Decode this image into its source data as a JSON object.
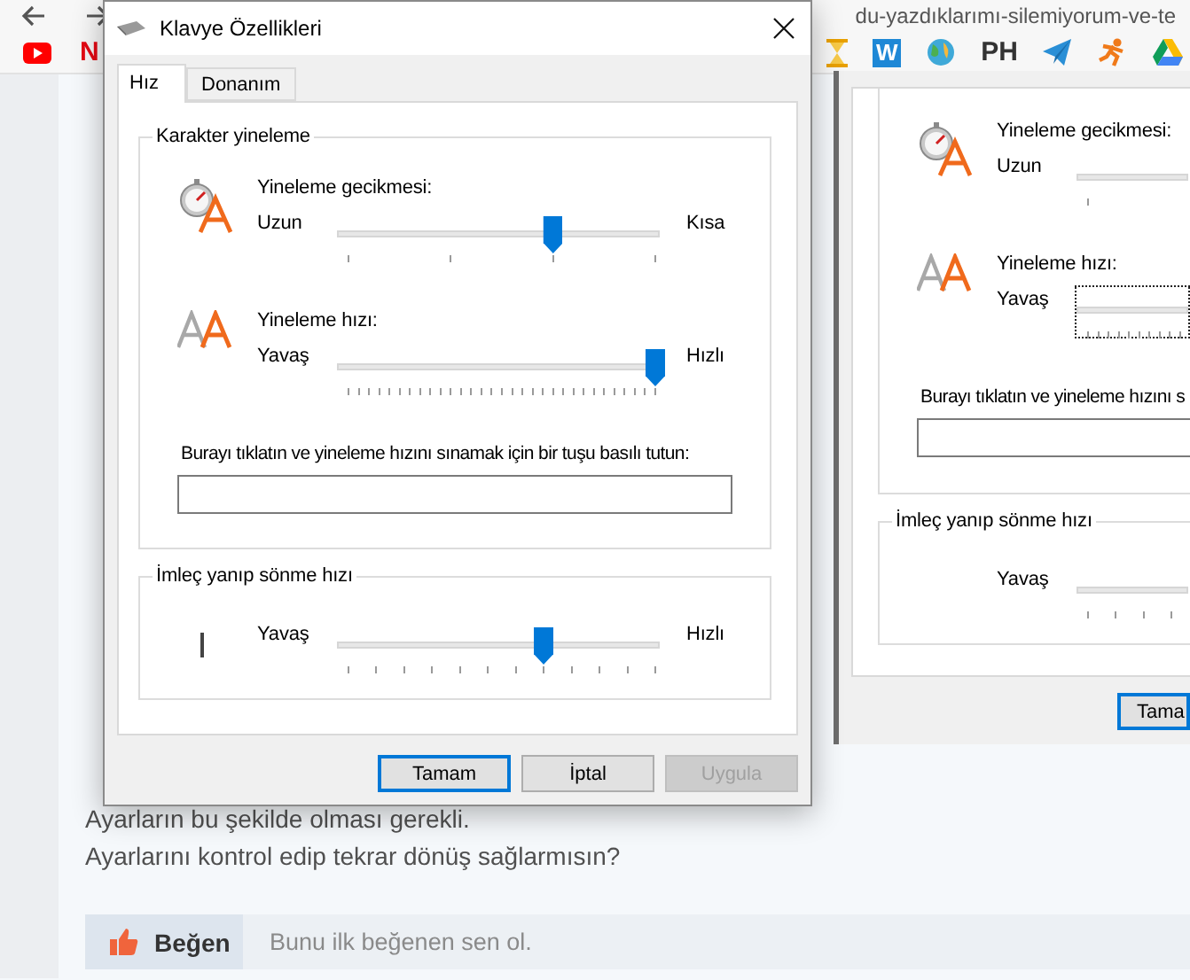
{
  "browser": {
    "address": "du-yazdıklarımı-silemiyorum-ve-te",
    "bookmarks_left": [
      {
        "kind": "play"
      },
      {
        "kind": "letter",
        "label": "N",
        "color": "#e50914"
      }
    ],
    "bookmarks_right": [
      {
        "kind": "hourglass"
      },
      {
        "kind": "tile",
        "label": "W"
      },
      {
        "kind": "globe"
      },
      {
        "kind": "letter",
        "label": "PH",
        "color": "#333333"
      },
      {
        "kind": "plane"
      },
      {
        "kind": "runner"
      },
      {
        "kind": "drive"
      }
    ]
  },
  "post": {
    "lines": [
      "Ayarların bu şekilde olması gerekli.",
      "Ayarlarını kontrol edip tekrar dönüş sağlarmısın?"
    ],
    "like_button": "Beğen",
    "like_note": "Bunu ilk beğenen sen ol."
  },
  "back_dialog": {
    "sliders": [
      {
        "kind": "delay",
        "title": "Yineleme gecikmesi:",
        "left": "Uzun",
        "focused": false
      },
      {
        "kind": "rate",
        "title": "Yineleme hızı:",
        "left": "Yavaş",
        "focused": true
      }
    ],
    "test_label": "Burayı tıklatın ve yineleme hızını s",
    "blink_title": "İmleç yanıp sönme hızı",
    "blink": {
      "kind": "blink",
      "left": "Yavaş",
      "cursor_visible": false
    },
    "button": "Tama"
  },
  "dialog": {
    "title": "Klavye Özellikleri",
    "tabs": [
      {
        "label": "Hız",
        "selected": true
      },
      {
        "label": "Donanım",
        "selected": false
      }
    ],
    "repeat_title": "Karakter yineleme",
    "sliders": [
      {
        "kind": "delay",
        "title": "Yineleme gecikmesi:",
        "left": "Uzun",
        "right": "Kısa",
        "level": 0.667
      },
      {
        "kind": "rate",
        "title": "Yineleme hızı:",
        "left": "Yavaş",
        "right": "Hızlı",
        "level": 1
      }
    ],
    "test_label": "Burayı tıklatın ve yineleme hızını sınamak için bir tuşu basılı tutun:",
    "blink_title": "İmleç yanıp sönme hızı",
    "blink": {
      "kind": "blink",
      "left": "Yavaş",
      "right": "Hızlı",
      "level": 0.636,
      "cursor_visible": true
    },
    "buttons": [
      {
        "label": "Tamam",
        "default": true,
        "disabled": false
      },
      {
        "label": "İptal",
        "default": false,
        "disabled": false
      },
      {
        "label": "Uygula",
        "default": false,
        "disabled": true
      }
    ]
  }
}
